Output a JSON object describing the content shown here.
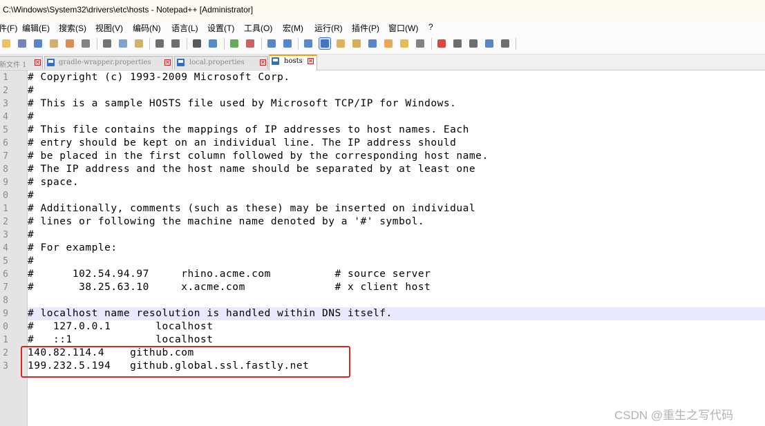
{
  "window": {
    "title": "C:\\Windows\\System32\\drivers\\etc\\hosts - Notepad++ [Administrator]"
  },
  "menu": [
    {
      "label": "件(F)",
      "name": "menu-file"
    },
    {
      "label": "编辑(E)",
      "name": "menu-edit"
    },
    {
      "label": "搜索(S)",
      "name": "menu-search"
    },
    {
      "label": "视图(V)",
      "name": "menu-view"
    },
    {
      "label": "编码(N)",
      "name": "menu-encoding"
    },
    {
      "label": "语言(L)",
      "name": "menu-language"
    },
    {
      "label": "设置(T)",
      "name": "menu-settings"
    },
    {
      "label": "工具(O)",
      "name": "menu-tools"
    },
    {
      "label": "宏(M)",
      "name": "menu-macro"
    },
    {
      "label": "运行(R)",
      "name": "menu-run"
    },
    {
      "label": "插件(P)",
      "name": "menu-plugins"
    },
    {
      "label": "窗口(W)",
      "name": "menu-window"
    },
    {
      "label": "?",
      "name": "menu-help"
    }
  ],
  "toolbar": [
    {
      "icon": "open-folder-icon",
      "color": "#e6b84a"
    },
    {
      "icon": "save-icon",
      "color": "#5a6fa8"
    },
    {
      "icon": "save-all-icon",
      "color": "#3f6fc0"
    },
    {
      "icon": "close-file-icon",
      "color": "#c7a25a"
    },
    {
      "icon": "close-all-icon",
      "color": "#d07a3a"
    },
    {
      "icon": "print-icon",
      "color": "#6d6d6d"
    },
    {
      "icon": "cut-icon",
      "color": "#5b5b5b"
    },
    {
      "icon": "copy-icon",
      "color": "#6c8fc8"
    },
    {
      "icon": "paste-icon",
      "color": "#c9a44c"
    },
    {
      "icon": "undo-icon",
      "color": "#555555"
    },
    {
      "icon": "redo-icon",
      "color": "#555555"
    },
    {
      "icon": "find-icon",
      "color": "#3c3c3c"
    },
    {
      "icon": "replace-icon",
      "color": "#3a74c4"
    },
    {
      "icon": "zoom-in-icon",
      "color": "#4f9a3d"
    },
    {
      "icon": "zoom-out-icon",
      "color": "#c04848"
    },
    {
      "icon": "sync-scroll-icon",
      "color": "#3f6fc0"
    },
    {
      "icon": "word-wrap-icon",
      "color": "#3f6fc0"
    },
    {
      "icon": "show-all-characters-icon",
      "color": "#3a74c4"
    },
    {
      "icon": "indent-guide-icon",
      "color": "#2d5fb5",
      "active": true
    },
    {
      "icon": "user-defined-language-icon",
      "color": "#d8a43c"
    },
    {
      "icon": "document-map-icon",
      "color": "#caa23e"
    },
    {
      "icon": "document-list-icon",
      "color": "#3f6fc0"
    },
    {
      "icon": "function-list-icon",
      "color": "#e39a3a"
    },
    {
      "icon": "folder-as-workspace-icon",
      "color": "#e0b03c"
    },
    {
      "icon": "monitoring-icon",
      "color": "#6d6d6d"
    },
    {
      "icon": "record-macro-icon",
      "color": "#d4242a"
    },
    {
      "icon": "stop-recording-icon",
      "color": "#555555"
    },
    {
      "icon": "play-macro-icon",
      "color": "#555555"
    },
    {
      "icon": "run-macro-multiple-icon",
      "color": "#3f6fc0"
    },
    {
      "icon": "save-macro-icon",
      "color": "#555555"
    }
  ],
  "tabs": [
    {
      "label": "新文件 1",
      "active": false
    },
    {
      "label": "gradle-wrapper.properties",
      "active": false
    },
    {
      "label": "local.properties",
      "active": false
    },
    {
      "label": "hosts",
      "active": true
    }
  ],
  "editor": {
    "line_numbers": [
      "1",
      "2",
      "3",
      "4",
      "5",
      "6",
      "7",
      "8",
      "9",
      "0",
      "1",
      "2",
      "3",
      "4",
      "5",
      "6",
      "7",
      "8",
      "9",
      "0",
      "1",
      "2",
      "3"
    ],
    "lines": [
      "# Copyright (c) 1993-2009 Microsoft Corp.",
      "#",
      "# This is a sample HOSTS file used by Microsoft TCP/IP for Windows.",
      "#",
      "# This file contains the mappings of IP addresses to host names. Each",
      "# entry should be kept on an individual line. The IP address should",
      "# be placed in the first column followed by the corresponding host name.",
      "# The IP address and the host name should be separated by at least one",
      "# space.",
      "#",
      "# Additionally, comments (such as these) may be inserted on individual",
      "# lines or following the machine name denoted by a '#' symbol.",
      "#",
      "# For example:",
      "#",
      "#      102.54.94.97     rhino.acme.com          # source server",
      "#       38.25.63.10     x.acme.com              # x client host",
      "",
      "# localhost name resolution is handled within DNS itself.",
      "#   127.0.0.1       localhost",
      "#   ::1             localhost",
      "140.82.114.4    github.com",
      "199.232.5.194   github.global.ssl.fastly.net"
    ],
    "current_line": 19
  },
  "watermark": "CSDN @重生之写代码",
  "colors": {
    "highlight_box": "#e0211c",
    "current_line_bg": "#e8e8ff",
    "active_tab_accent": "#f6a100"
  }
}
